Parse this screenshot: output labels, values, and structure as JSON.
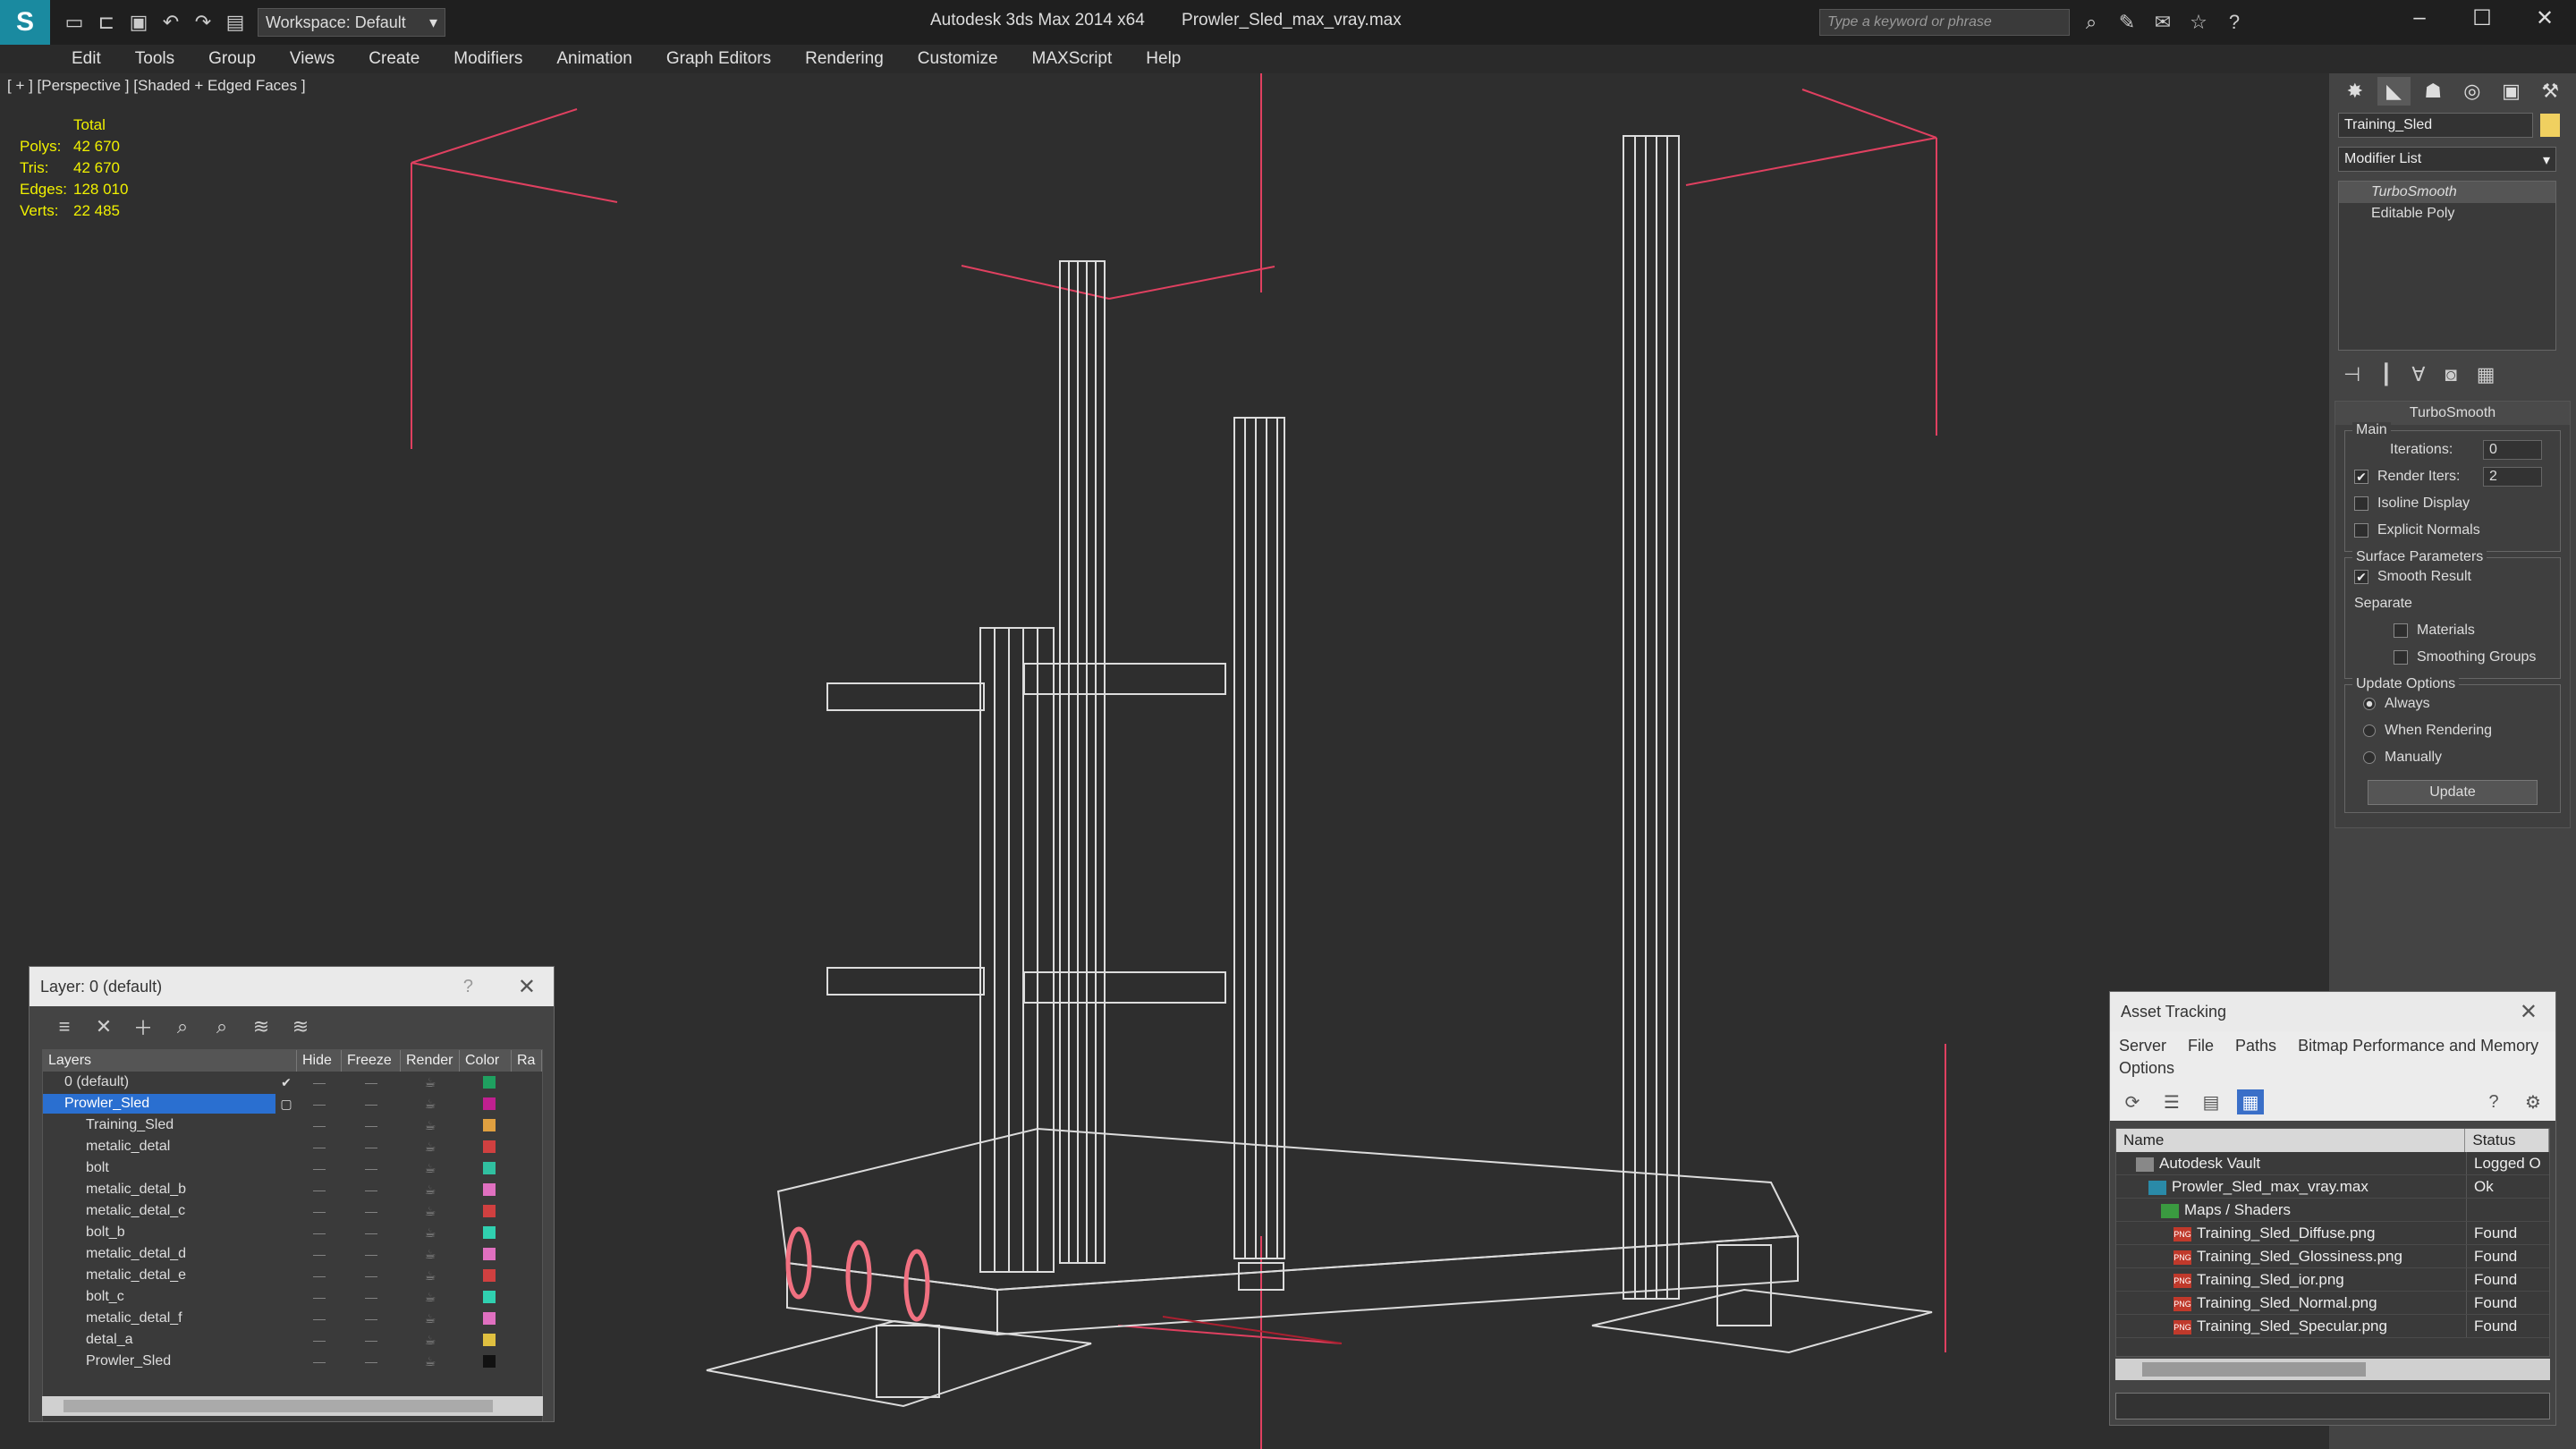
{
  "app": {
    "title": "Autodesk 3ds Max 2014 x64",
    "file": "Prowler_Sled_max_vray.max",
    "workspace": "Workspace: Default",
    "search_placeholder": "Type a keyword or phrase"
  },
  "menu": [
    "Edit",
    "Tools",
    "Group",
    "Views",
    "Create",
    "Modifiers",
    "Animation",
    "Graph Editors",
    "Rendering",
    "Customize",
    "MAXScript",
    "Help"
  ],
  "viewport": {
    "label": "[ + ] [Perspective ] [Shaded + Edged Faces ]",
    "stats_header": "Total",
    "stats": [
      {
        "k": "Polys:",
        "v": "42 670"
      },
      {
        "k": "Tris:",
        "v": "42 670"
      },
      {
        "k": "Edges:",
        "v": "128 010"
      },
      {
        "k": "Verts:",
        "v": "22 485"
      }
    ]
  },
  "layers": {
    "title": "Layer: 0 (default)",
    "help": "?",
    "headers": [
      "Layers",
      "Hide",
      "Freeze",
      "Render",
      "Color",
      "Ra"
    ],
    "rows": [
      {
        "name": "0 (default)",
        "color": "#1fa060",
        "indent": 1
      },
      {
        "name": "Prowler_Sled",
        "color": "#c02090",
        "indent": 1,
        "selected": true
      },
      {
        "name": "Training_Sled",
        "color": "#e0a040",
        "indent": 2
      },
      {
        "name": "metalic_detal",
        "color": "#d04040",
        "indent": 2
      },
      {
        "name": "bolt",
        "color": "#30c0a0",
        "indent": 2
      },
      {
        "name": "metalic_detal_b",
        "color": "#e070c0",
        "indent": 2
      },
      {
        "name": "metalic_detal_c",
        "color": "#d04040",
        "indent": 2
      },
      {
        "name": "bolt_b",
        "color": "#30d0b0",
        "indent": 2
      },
      {
        "name": "metalic_detal_d",
        "color": "#e070c0",
        "indent": 2
      },
      {
        "name": "metalic_detal_e",
        "color": "#d04040",
        "indent": 2
      },
      {
        "name": "bolt_c",
        "color": "#30d0b0",
        "indent": 2
      },
      {
        "name": "metalic_detal_f",
        "color": "#e070c0",
        "indent": 2
      },
      {
        "name": "detal_a",
        "color": "#e0c040",
        "indent": 2
      },
      {
        "name": "Prowler_Sled",
        "color": "#111111",
        "indent": 2
      }
    ]
  },
  "command_panel": {
    "object_name": "Training_Sled",
    "modifier_list": "Modifier List",
    "stack": [
      "TurboSmooth",
      "Editable Poly"
    ],
    "rollout_title": "TurboSmooth",
    "main_label": "Main",
    "iterations_label": "Iterations:",
    "iterations_value": "0",
    "render_iters_label": "Render Iters:",
    "render_iters_value": "2",
    "isoline_label": "Isoline Display",
    "explicit_normals_label": "Explicit Normals",
    "surface_label": "Surface Parameters",
    "smooth_result_label": "Smooth Result",
    "separate_label": "Separate",
    "materials_label": "Materials",
    "smoothing_groups_label": "Smoothing Groups",
    "update_options_label": "Update Options",
    "always_label": "Always",
    "when_rendering_label": "When Rendering",
    "manually_label": "Manually",
    "update_button": "Update"
  },
  "asset_tracking": {
    "title": "Asset Tracking",
    "menu": [
      "Server",
      "File",
      "Paths",
      "Bitmap Performance and Memory",
      "Options"
    ],
    "headers": [
      "Name",
      "Status"
    ],
    "rows": [
      {
        "name": "Autodesk Vault",
        "status": "Logged O",
        "indent": 1,
        "icon": "vault"
      },
      {
        "name": "Prowler_Sled_max_vray.max",
        "status": "Ok",
        "indent": 2,
        "icon": "max"
      },
      {
        "name": "Maps / Shaders",
        "status": "",
        "indent": 3,
        "icon": "folder"
      },
      {
        "name": "Training_Sled_Diffuse.png",
        "status": "Found",
        "indent": 4,
        "icon": "png"
      },
      {
        "name": "Training_Sled_Glossiness.png",
        "status": "Found",
        "indent": 4,
        "icon": "png"
      },
      {
        "name": "Training_Sled_ior.png",
        "status": "Found",
        "indent": 4,
        "icon": "png"
      },
      {
        "name": "Training_Sled_Normal.png",
        "status": "Found",
        "indent": 4,
        "icon": "png"
      },
      {
        "name": "Training_Sled_Specular.png",
        "status": "Found",
        "indent": 4,
        "icon": "png"
      }
    ]
  },
  "colors": {
    "accent": "#2a6fd0",
    "viewport_bg": "#2e2e2e",
    "stats": "#f0f000",
    "wire": "#ffffff",
    "bounds": "#e04060"
  }
}
